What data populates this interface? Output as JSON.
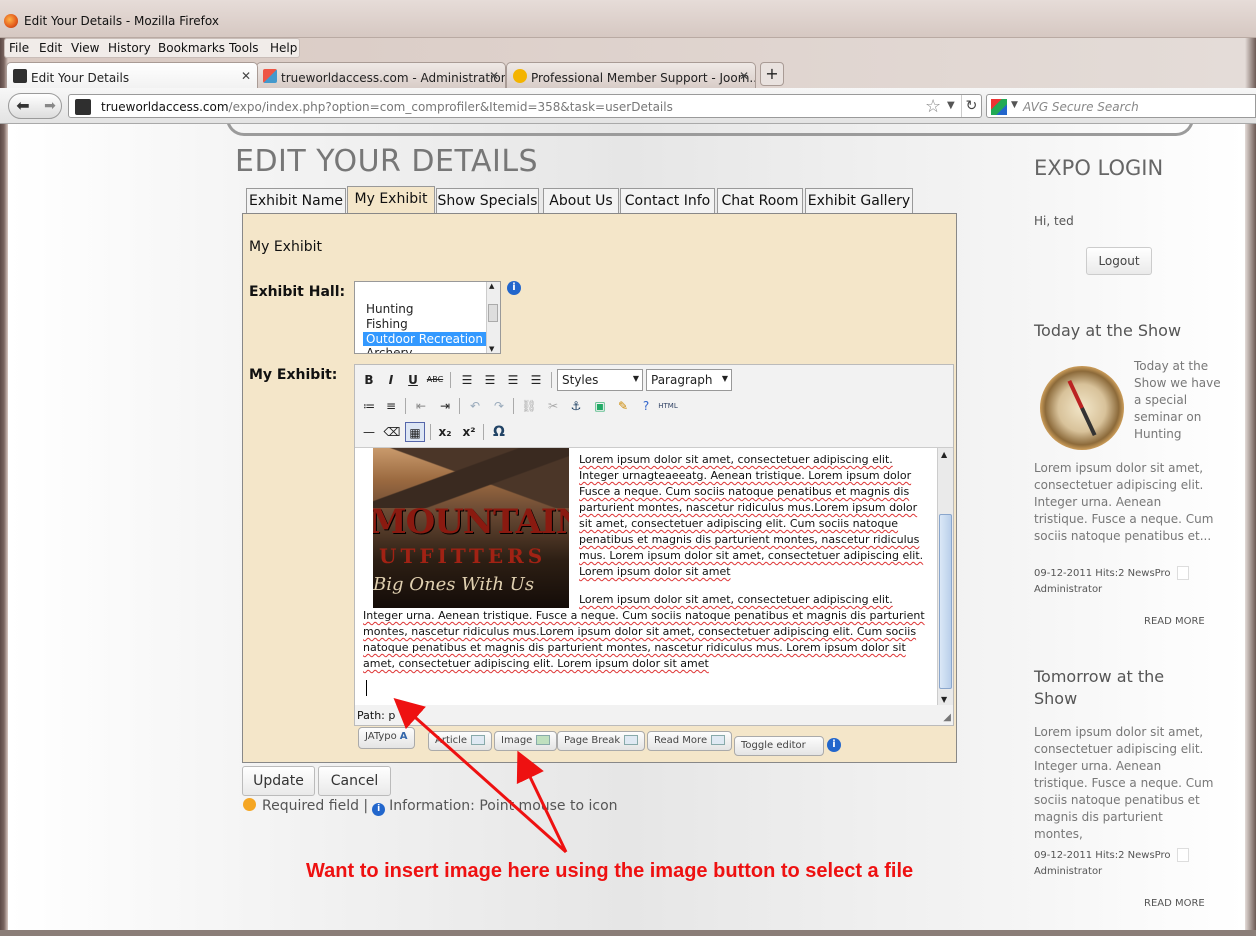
{
  "window": {
    "title": "Edit Your Details - Mozilla Firefox"
  },
  "menu": [
    "File",
    "Edit",
    "View",
    "History",
    "Bookmarks",
    "Tools",
    "Help"
  ],
  "tabs": [
    {
      "label": "Edit Your Details",
      "active": true
    },
    {
      "label": "trueworldaccess.com - Administration",
      "active": false
    },
    {
      "label": "Professional Member Support - Joom...",
      "active": false
    }
  ],
  "url": {
    "domain": "trueworldaccess.com",
    "path": "/expo/index.php?option=com_comprofiler&Itemid=358&task=userDetails"
  },
  "search": {
    "placeholder": "AVG Secure Search"
  },
  "page": {
    "title": "EDIT YOUR DETAILS",
    "tabs": [
      "Exhibit Name",
      "My Exhibit",
      "Show Specials",
      "About Us",
      "Contact Info",
      "Chat Room",
      "Exhibit Gallery"
    ],
    "selected_tab": "My Exhibit",
    "panel_heading": "My Exhibit",
    "hall_label": "Exhibit Hall:",
    "hall_options": [
      "Hunting",
      "Fishing",
      "Outdoor Recreation",
      "Archery"
    ],
    "hall_selected": "Outdoor Recreation",
    "exhibit_label": "My Exhibit:",
    "editor": {
      "styles_select": "Styles",
      "format_select": "Paragraph",
      "image": {
        "line1": "MOUNTAIN",
        "line2": "UTFITTERS",
        "line3": "Big Ones With Us"
      },
      "para1": "Lorem ipsum dolor sit amet, consectetuer adipiscing elit. Integer urnagteaeeatg. Aenean tristique. Lorem ipsum dolor Fusce a neque. Cum sociis natoque penatibus et magnis dis parturient montes, nascetur ridiculus mus.Lorem ipsum dolor sit amet, consectetuer adipiscing elit. Cum sociis natoque penatibus et magnis dis parturient montes, nascetur ridiculus mus. Lorem ipsum dolor sit amet, consectetuer adipiscing elit. Lorem ipsum dolor sit amet",
      "para2": "Lorem ipsum dolor sit amet, consectetuer adipiscing elit. Integer urna. Aenean tristique. Fusce a neque. Cum sociis natoque penatibus et magnis dis parturient montes, nascetur ridiculus mus.Lorem ipsum dolor sit amet, consectetuer adipiscing elit. Cum sociis natoque penatibus et magnis dis parturient montes, nascetur ridiculus mus. Lorem ipsum dolor sit amet, consectetuer adipiscing elit. Lorem ipsum dolor sit amet",
      "path": "Path: p"
    },
    "extra_buttons": [
      "JATypo",
      "Article",
      "Image",
      "Page Break",
      "Read More",
      "Toggle editor"
    ],
    "update": "Update",
    "cancel": "Cancel",
    "required": "Required field |",
    "information": "Information: Point mouse to icon",
    "annotation": "Want to insert image here using the image button to select a file"
  },
  "sidebar": {
    "login_title": "EXPO LOGIN",
    "greeting": "Hi, ted",
    "logout": "Logout",
    "today_title": "Today at the Show",
    "today_text": "Today at the Show we have a special seminar on Hunting",
    "today_rest": "Lorem ipsum dolor sit amet, consectetuer adipiscing elit. Integer urna. Aenean tristique. Fusce a neque. Cum sociis natoque penatibus et...",
    "today_meta": "09-12-2011 Hits:2 NewsPro",
    "today_author": "Administrator",
    "read_more": "READ MORE",
    "tomorrow_title": "Tomorrow at the Show",
    "tomorrow_text": "Lorem ipsum dolor sit amet, consectetuer adipiscing elit. Integer urna. Aenean tristique. Fusce a neque. Cum sociis natoque penatibus et magnis dis parturient montes,",
    "tomorrow_meta": "09-12-2011 Hits:2 NewsPro",
    "tomorrow_author": "Administrator",
    "read_more2": "READ MORE"
  },
  "colors": {
    "panel": "#f4e6c9",
    "annotation": "#e11111",
    "selection": "#3399ff"
  }
}
